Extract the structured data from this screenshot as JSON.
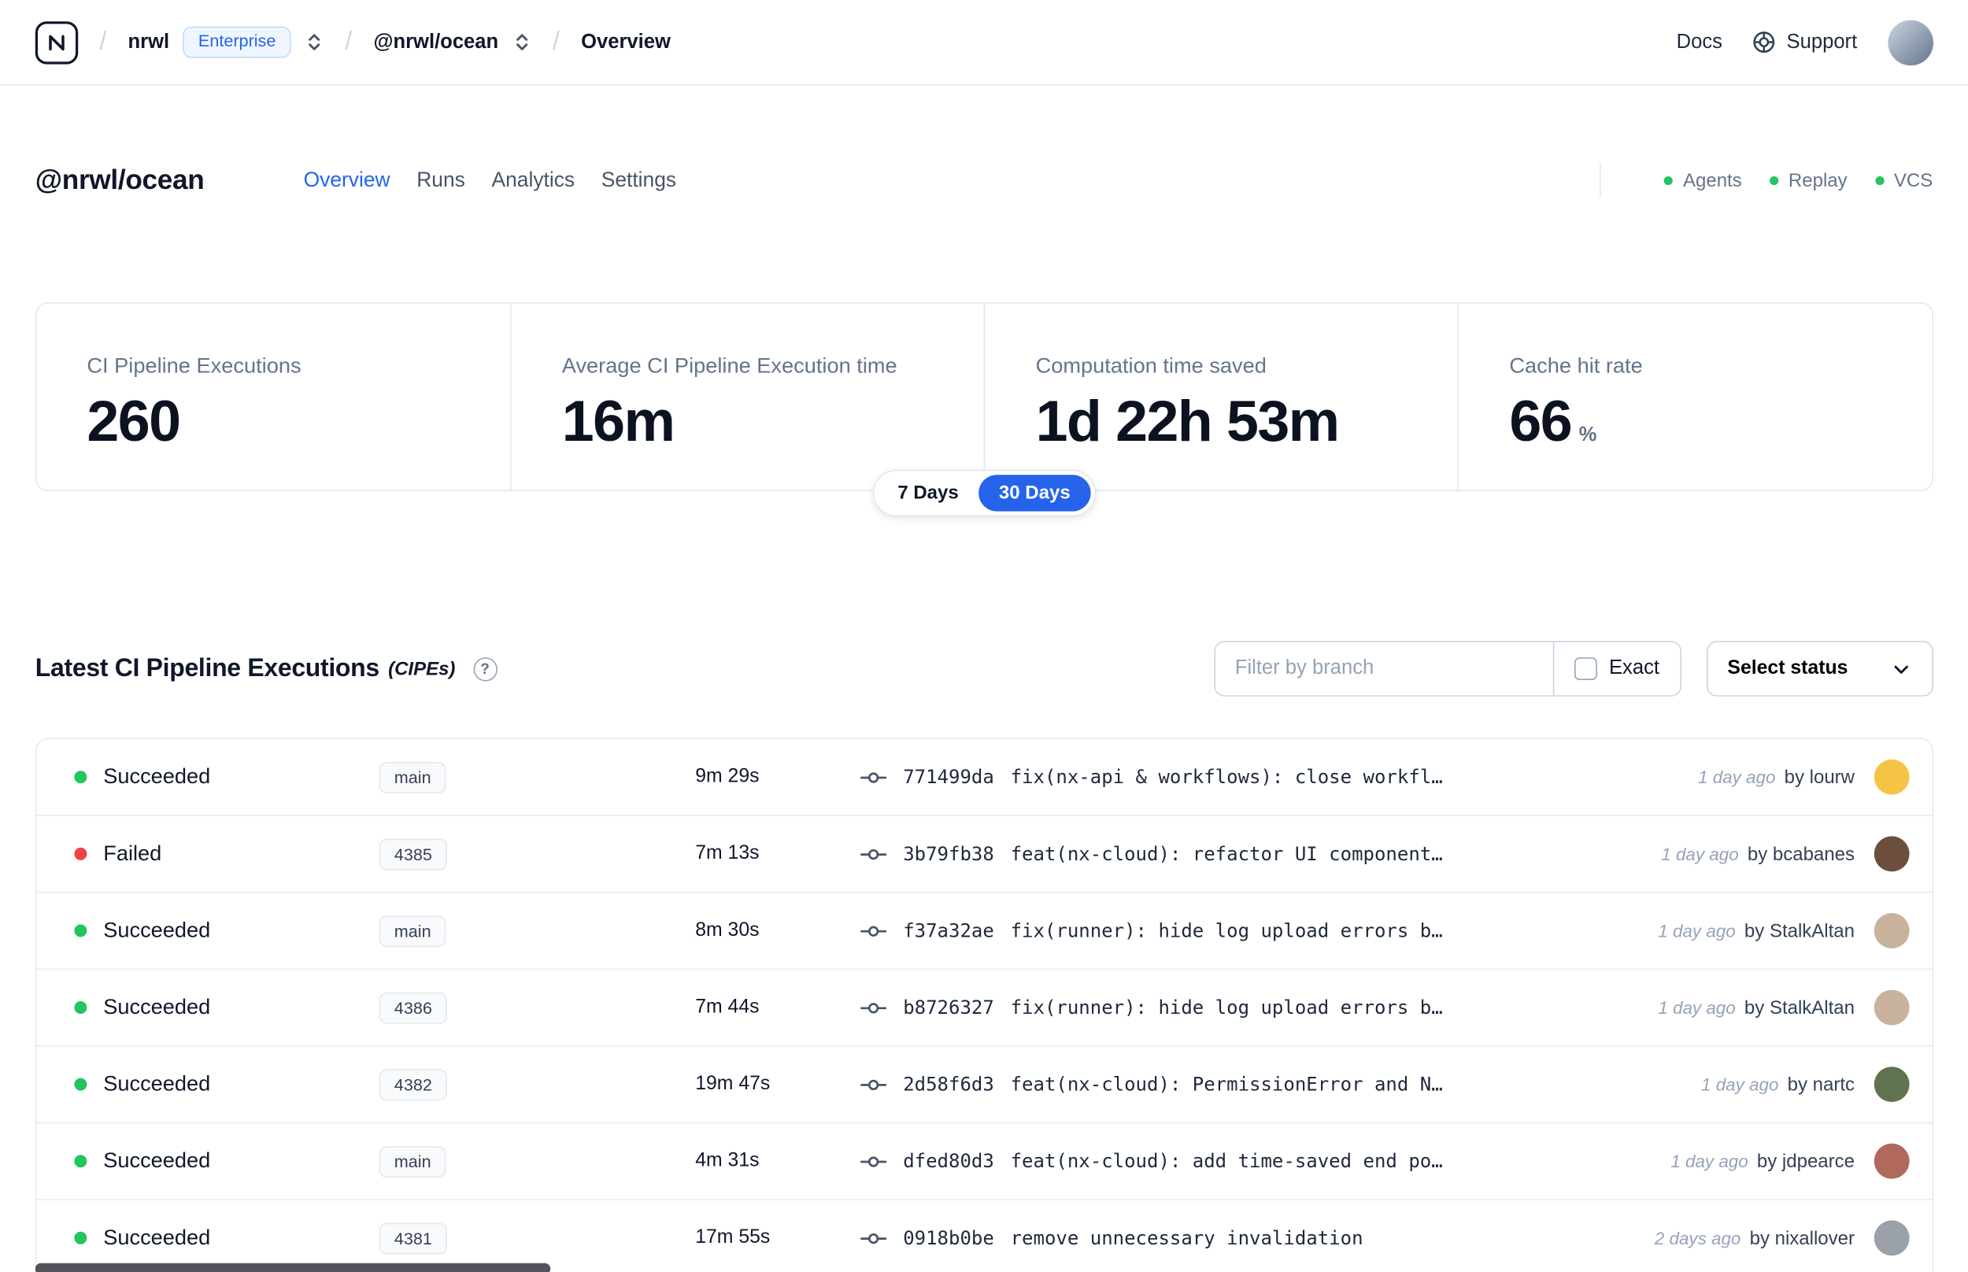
{
  "colors": {
    "accent": "#2563eb",
    "green": "#22c55e",
    "red": "#ef4444"
  },
  "icons": {
    "slash": "/",
    "help_glyph": "?"
  },
  "nav": {
    "org": "nrwl",
    "org_badge": "Enterprise",
    "workspace": "@nrwl/ocean",
    "page": "Overview",
    "docs": "Docs",
    "support": "Support"
  },
  "header": {
    "title": "@nrwl/ocean",
    "tabs": [
      {
        "label": "Overview",
        "active": true
      },
      {
        "label": "Runs",
        "active": false
      },
      {
        "label": "Analytics",
        "active": false
      },
      {
        "label": "Settings",
        "active": false
      }
    ],
    "env": [
      "Agents",
      "Replay",
      "VCS"
    ]
  },
  "stats": {
    "cards": [
      {
        "label": "CI Pipeline Executions",
        "value": "260",
        "suffix": ""
      },
      {
        "label": "Average CI Pipeline Execution time",
        "value": "16m",
        "suffix": ""
      },
      {
        "label": "Computation time saved",
        "value": "1d 22h 53m",
        "suffix": ""
      },
      {
        "label": "Cache hit rate",
        "value": "66",
        "suffix": "%"
      }
    ],
    "range_toggle": {
      "options": [
        "7 Days",
        "30 Days"
      ],
      "selected": "30 Days"
    }
  },
  "cipes": {
    "title": "Latest CI Pipeline Executions",
    "title_suffix": "(CIPEs)",
    "filter": {
      "placeholder": "Filter by branch",
      "exact_label": "Exact",
      "status_label": "Select status"
    },
    "rows": [
      {
        "status": "Succeeded",
        "branch": "main",
        "duration": "9m 29s",
        "commit_hash": "771499da",
        "commit_message": "fix(nx-api & workflows): close workfl…",
        "time": "1 day ago",
        "author": "by lourw",
        "avatar_color": "#f6c444"
      },
      {
        "status": "Failed",
        "branch": "4385",
        "duration": "7m 13s",
        "commit_hash": "3b79fb38",
        "commit_message": "feat(nx-cloud): refactor UI component…",
        "time": "1 day ago",
        "author": "by bcabanes",
        "avatar_color": "#6b4f3a"
      },
      {
        "status": "Succeeded",
        "branch": "main",
        "duration": "8m 30s",
        "commit_hash": "f37a32ae",
        "commit_message": "fix(runner): hide log upload errors b…",
        "time": "1 day ago",
        "author": "by StalkAltan",
        "avatar_color": "#c9b29b"
      },
      {
        "status": "Succeeded",
        "branch": "4386",
        "duration": "7m 44s",
        "commit_hash": "b8726327",
        "commit_message": "fix(runner): hide log upload errors b…",
        "time": "1 day ago",
        "author": "by StalkAltan",
        "avatar_color": "#c9b29b"
      },
      {
        "status": "Succeeded",
        "branch": "4382",
        "duration": "19m 47s",
        "commit_hash": "2d58f6d3",
        "commit_message": "feat(nx-cloud): PermissionError and N…",
        "time": "1 day ago",
        "author": "by nartc",
        "avatar_color": "#5f7350"
      },
      {
        "status": "Succeeded",
        "branch": "main",
        "duration": "4m 31s",
        "commit_hash": "dfed80d3",
        "commit_message": "feat(nx-cloud): add time-saved end po…",
        "time": "1 day ago",
        "author": "by jdpearce",
        "avatar_color": "#b0695c"
      },
      {
        "status": "Succeeded",
        "branch": "4381",
        "duration": "17m 55s",
        "commit_hash": "0918b0be",
        "commit_message": "remove unnecessary invalidation",
        "time": "2 days ago",
        "author": "by nixallover",
        "avatar_color": "#9aa1a9"
      }
    ]
  }
}
